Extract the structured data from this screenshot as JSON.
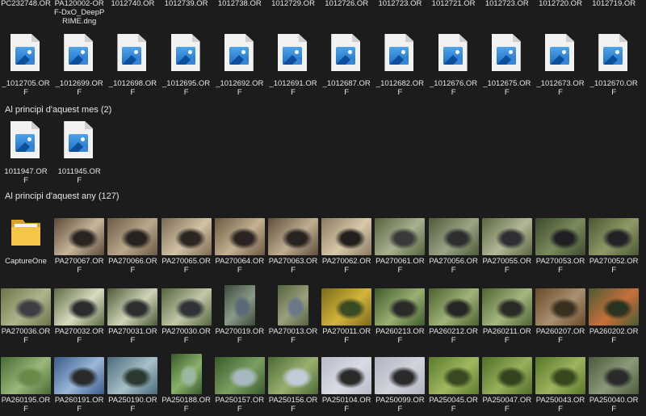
{
  "rows": {
    "top_labels": [
      {
        "l1": "PC232748.OR",
        "l2": ""
      },
      {
        "l1": "PA120002-OR",
        "l2": "F-DxO_DeepP",
        "l3": "RIME.dng"
      },
      {
        "l1": "1012740.OR",
        "l2": ""
      },
      {
        "l1": "1012739.OR",
        "l2": ""
      },
      {
        "l1": "1012738.OR",
        "l2": ""
      },
      {
        "l1": "1012729.OR",
        "l2": ""
      },
      {
        "l1": "1012726.OR",
        "l2": ""
      },
      {
        "l1": "1012723.OR",
        "l2": ""
      },
      {
        "l1": "1012721.OR",
        "l2": ""
      },
      {
        "l1": "1012723.OR",
        "l2": ""
      },
      {
        "l1": "1012720.OR",
        "l2": ""
      },
      {
        "l1": "1012719.OR",
        "l2": ""
      }
    ],
    "this_month_tail": [
      {
        "l1": "_1012705.OR",
        "l2": "F"
      },
      {
        "l1": "_1012699.OR",
        "l2": "F"
      },
      {
        "l1": "_1012698.OR",
        "l2": "F"
      },
      {
        "l1": "_1012695.OR",
        "l2": "F"
      },
      {
        "l1": "_1012692.OR",
        "l2": "F"
      },
      {
        "l1": "_1012691.OR",
        "l2": "F"
      },
      {
        "l1": "_1012687.OR",
        "l2": "F"
      },
      {
        "l1": "_1012682.OR",
        "l2": "F"
      },
      {
        "l1": "_1012676.OR",
        "l2": "F"
      },
      {
        "l1": "_1012675.OR",
        "l2": "F"
      },
      {
        "l1": "_1012673.OR",
        "l2": "F"
      },
      {
        "l1": "_1012670.OR",
        "l2": "F"
      }
    ]
  },
  "groups": {
    "month_header": "Al principi d'aquest mes (2)",
    "month_items": [
      {
        "l1": "1011947.OR",
        "l2": "F"
      },
      {
        "l1": "1011945.OR",
        "l2": "F"
      }
    ],
    "year_header": "Al principi d'aquest any (127)",
    "year_row1": [
      {
        "l1": "CaptureOne",
        "l2": "",
        "kind": "folder"
      },
      {
        "l1": "PA270067.OR",
        "l2": "F",
        "kind": "photo",
        "c1": "#5a4a38",
        "c2": "#c8b69a",
        "c3": "#2a2420"
      },
      {
        "l1": "PA270066.OR",
        "l2": "F",
        "kind": "photo",
        "c1": "#6b5a44",
        "c2": "#b9a88b",
        "c3": "#262220"
      },
      {
        "l1": "PA270065.OR",
        "l2": "F",
        "kind": "photo",
        "c1": "#7a6a52",
        "c2": "#d2c2a6",
        "c3": "#2c2622"
      },
      {
        "l1": "PA270064.OR",
        "l2": "F",
        "kind": "photo",
        "c1": "#6a5842",
        "c2": "#c4b292",
        "c3": "#2a2420"
      },
      {
        "l1": "PA270063.OR",
        "l2": "F",
        "kind": "photo",
        "c1": "#5e4e3c",
        "c2": "#bfae90",
        "c3": "#282220"
      },
      {
        "l1": "PA270062.OR",
        "l2": "F",
        "kind": "photo",
        "c1": "#8a7a62",
        "c2": "#d8c8aa",
        "c3": "#221e1c"
      },
      {
        "l1": "PA270061.OR",
        "l2": "F",
        "kind": "photo",
        "c1": "#55623c",
        "c2": "#a8b090",
        "c3": "#3a3a3a"
      },
      {
        "l1": "PA270056.OR",
        "l2": "F",
        "kind": "photo",
        "c1": "#4e5a3a",
        "c2": "#9aa484",
        "c3": "#2e2e30"
      },
      {
        "l1": "PA270055.OR",
        "l2": "F",
        "kind": "photo",
        "c1": "#5a6640",
        "c2": "#b2b898",
        "c3": "#303034"
      },
      {
        "l1": "PA270053.OR",
        "l2": "F",
        "kind": "photo",
        "c1": "#3f4a30",
        "c2": "#7a8a5a",
        "c3": "#202024"
      },
      {
        "l1": "PA270052.OR",
        "l2": "F",
        "kind": "photo",
        "c1": "#4a5634",
        "c2": "#8e9a66",
        "c3": "#222226"
      }
    ],
    "year_row2": [
      {
        "l1": "PA270036.OR",
        "l2": "F",
        "c1": "#6a7448",
        "c2": "#b0b48c",
        "c3": "#3c3e44",
        "tall": false
      },
      {
        "l1": "PA270032.OR",
        "l2": "F",
        "c1": "#5c6a44",
        "c2": "#d8dcc0",
        "c3": "#2a2c2e",
        "tall": false
      },
      {
        "l1": "PA270031.OR",
        "l2": "F",
        "c1": "#4c5a38",
        "c2": "#cfd4b8",
        "c3": "#2c2e30",
        "tall": false
      },
      {
        "l1": "PA270030.OR",
        "l2": "F",
        "c1": "#566440",
        "c2": "#c2c8a8",
        "c3": "#303236",
        "tall": false
      },
      {
        "l1": "PA270019.OR",
        "l2": "F",
        "c1": "#3c4a3c",
        "c2": "#8a9a88",
        "c3": "#5a6a78",
        "tall": true
      },
      {
        "l1": "PA270013.OR",
        "l2": "F",
        "c1": "#56623e",
        "c2": "#9aa07c",
        "c3": "#6a7888",
        "tall": true
      },
      {
        "l1": "PA270011.OR",
        "l2": "F",
        "c1": "#7a6a1a",
        "c2": "#d4b43a",
        "c3": "#3a4a22",
        "tall": false
      },
      {
        "l1": "PA260213.OR",
        "l2": "F",
        "c1": "#3e5a2c",
        "c2": "#9ab070",
        "c3": "#2a2a28",
        "tall": false
      },
      {
        "l1": "PA260212.OR",
        "l2": "F",
        "c1": "#4a602e",
        "c2": "#a0b478",
        "c3": "#262624",
        "tall": false
      },
      {
        "l1": "PA260211.OR",
        "l2": "F",
        "c1": "#4e6434",
        "c2": "#a6b67e",
        "c3": "#2a2a26",
        "tall": false
      },
      {
        "l1": "PA260207.OR",
        "l2": "F",
        "c1": "#6a4a2a",
        "c2": "#a89070",
        "c3": "#3a3020",
        "tall": false
      },
      {
        "l1": "PA260202.OR",
        "l2": "F",
        "c1": "#4a5a34",
        "c2": "#c8703a",
        "c3": "#2a3220",
        "tall": false
      }
    ],
    "year_row3": [
      {
        "l1": "PA260195.OR",
        "l2": "F",
        "c1": "#4a6a34",
        "c2": "#9ab87a",
        "c3": "#6a8a4a",
        "tall": false
      },
      {
        "l1": "PA260191.OR",
        "l2": "F",
        "c1": "#3a5a8a",
        "c2": "#9ab8d8",
        "c3": "#2a2a2a",
        "tall": false
      },
      {
        "l1": "PA250190.OR",
        "l2": "F",
        "c1": "#4a6a7a",
        "c2": "#a8c0c8",
        "c3": "#2a3a30",
        "tall": false
      },
      {
        "l1": "PA250188.OR",
        "l2": "F",
        "c1": "#3a5a2a",
        "c2": "#8ab06a",
        "c3": "#9ab8a0",
        "tall": true
      },
      {
        "l1": "PA250157.OR",
        "l2": "F",
        "c1": "#3a5a2c",
        "c2": "#7aa060",
        "c3": "#a8b8c0",
        "tall": false
      },
      {
        "l1": "PA250156.OR",
        "l2": "F",
        "c1": "#4a6a34",
        "c2": "#9ab070",
        "c3": "#c0ccd8",
        "tall": false
      },
      {
        "l1": "PA250104.OR",
        "l2": "F",
        "c1": "#b8bcc8",
        "c2": "#d8dce4",
        "c3": "#2a2a2a",
        "tall": false
      },
      {
        "l1": "PA250099.OR",
        "l2": "F",
        "c1": "#b0b4c0",
        "c2": "#d0d4dc",
        "c3": "#2a2a2a",
        "tall": false
      },
      {
        "l1": "PA250045.OR",
        "l2": "F",
        "c1": "#5a7a2a",
        "c2": "#a0b860",
        "c3": "#3a4a20",
        "tall": false
      },
      {
        "l1": "PA250047.OR",
        "l2": "F",
        "c1": "#4e6e28",
        "c2": "#98b05a",
        "c3": "#34441e",
        "tall": false
      },
      {
        "l1": "PA250043.OR",
        "l2": "F",
        "c1": "#567628",
        "c2": "#9eb45e",
        "c3": "#38481e",
        "tall": false
      },
      {
        "l1": "PA250040.OR",
        "l2": "F",
        "c1": "#4a5a3a",
        "c2": "#8a9a7a",
        "c3": "#2a2a2a",
        "tall": false
      }
    ]
  }
}
